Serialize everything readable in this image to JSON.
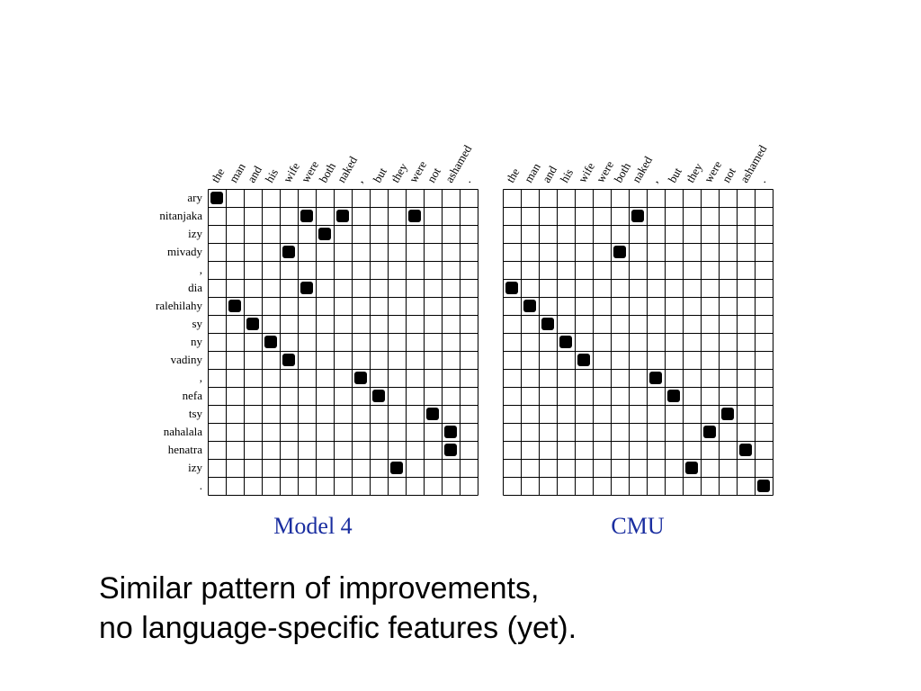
{
  "caption": "Similar pattern of improvements,\nno language-specific features (yet).",
  "columns": [
    "the",
    "man",
    "and",
    "his",
    "wife",
    "were",
    "both",
    "naked",
    ",",
    "but",
    "they",
    "were",
    "not",
    "ashamed",
    "."
  ],
  "rows": [
    "ary",
    "nitanjaka",
    "izy",
    "mivady",
    ",",
    "dia",
    "ralehilahy",
    "sy",
    "ny",
    "vadiny",
    ",",
    "nefa",
    "tsy",
    "nahalala",
    "henatra",
    "izy",
    "."
  ],
  "chart_data": [
    {
      "type": "heatmap",
      "title": "Model 4",
      "xlabel": "",
      "ylabel": "",
      "xticks": [
        "the",
        "man",
        "and",
        "his",
        "wife",
        "were",
        "both",
        "naked",
        ",",
        "but",
        "they",
        "were",
        "not",
        "ashamed",
        "."
      ],
      "yticks": [
        "ary",
        "nitanjaka",
        "izy",
        "mivady",
        ",",
        "dia",
        "ralehilahy",
        "sy",
        "ny",
        "vadiny",
        ",",
        "nefa",
        "tsy",
        "nahalala",
        "henatra",
        "izy",
        "."
      ],
      "cells": [
        [
          0,
          0
        ],
        [
          1,
          5
        ],
        [
          1,
          7
        ],
        [
          1,
          11
        ],
        [
          2,
          6
        ],
        [
          3,
          4
        ],
        [
          5,
          5
        ],
        [
          6,
          1
        ],
        [
          7,
          2
        ],
        [
          8,
          3
        ],
        [
          9,
          4
        ],
        [
          10,
          8
        ],
        [
          11,
          9
        ],
        [
          12,
          12
        ],
        [
          13,
          13
        ],
        [
          14,
          13
        ],
        [
          15,
          10
        ]
      ]
    },
    {
      "type": "heatmap",
      "title": "CMU",
      "xlabel": "",
      "ylabel": "",
      "xticks": [
        "the",
        "man",
        "and",
        "his",
        "wife",
        "were",
        "both",
        "naked",
        ",",
        "but",
        "they",
        "were",
        "not",
        "ashamed",
        "."
      ],
      "yticks": [
        "ary",
        "nitanjaka",
        "izy",
        "mivady",
        ",",
        "dia",
        "ralehilahy",
        "sy",
        "ny",
        "vadiny",
        ",",
        "nefa",
        "tsy",
        "nahalala",
        "henatra",
        "izy",
        "."
      ],
      "cells": [
        [
          1,
          7
        ],
        [
          3,
          6
        ],
        [
          5,
          0
        ],
        [
          6,
          1
        ],
        [
          7,
          2
        ],
        [
          8,
          3
        ],
        [
          9,
          4
        ],
        [
          10,
          8
        ],
        [
          11,
          9
        ],
        [
          12,
          12
        ],
        [
          13,
          11
        ],
        [
          14,
          13
        ],
        [
          15,
          10
        ],
        [
          16,
          14
        ]
      ]
    }
  ]
}
